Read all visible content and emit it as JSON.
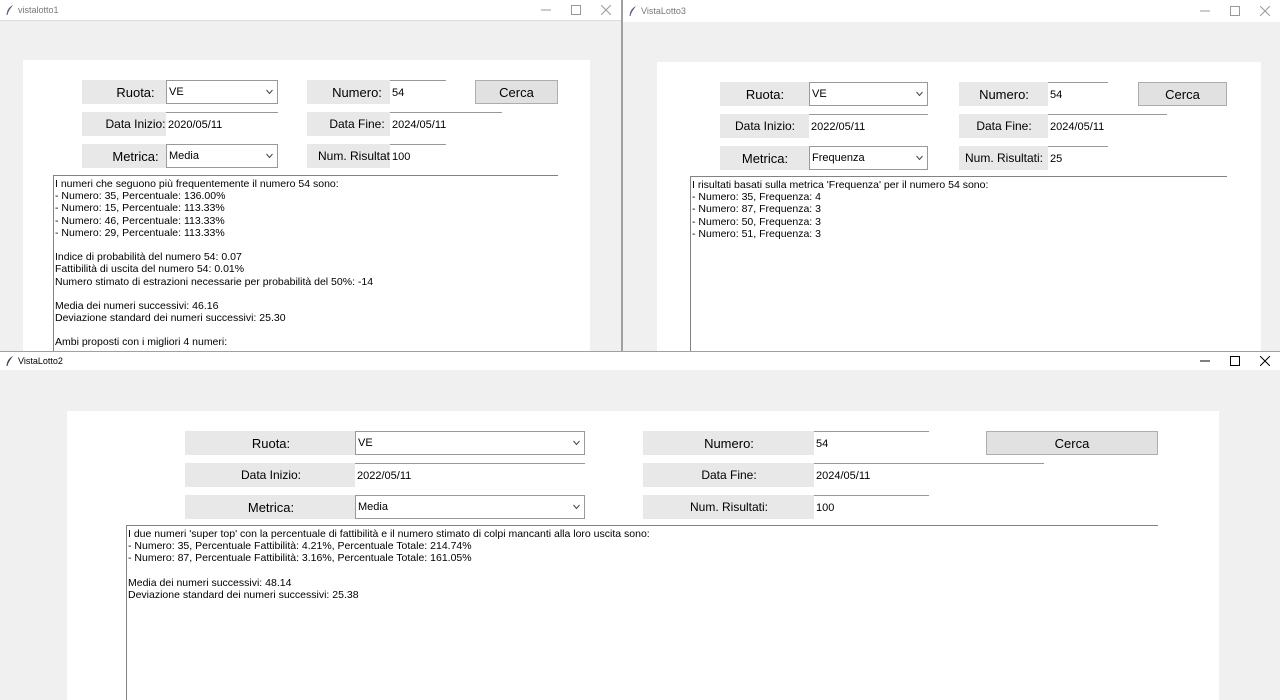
{
  "win1": {
    "title": "vistalotto1",
    "ruota_label": "Ruota:",
    "ruota_value": "VE",
    "numero_label": "Numero:",
    "numero_value": "54",
    "cerca_label": "Cerca",
    "data_inizio_label": "Data Inizio:",
    "data_inizio_value": "2020/05/11",
    "data_fine_label": "Data Fine:",
    "data_fine_value": "2024/05/11",
    "metrica_label": "Metrica:",
    "metrica_value": "Media",
    "num_risultati_label": "Num. Risultati:",
    "num_risultati_value": "100",
    "output_lines": [
      "I numeri che seguono più frequentemente il numero 54 sono:",
      "- Numero: 35, Percentuale: 136.00%",
      "- Numero: 15, Percentuale: 113.33%",
      "- Numero: 46, Percentuale: 113.33%",
      "- Numero: 29, Percentuale: 113.33%",
      "",
      "Indice di probabilità del numero 54: 0.07",
      "Fattibilità di uscita del numero 54: 0.01%",
      "Numero stimato di estrazioni necessarie per probabilità del 50%: -14",
      "",
      "Media dei numeri successivi: 46.16",
      "Deviazione standard dei numeri successivi: 25.30",
      "",
      "Ambi proposti con i migliori 4 numeri:"
    ]
  },
  "win3": {
    "title": "VistaLotto3",
    "ruota_label": "Ruota:",
    "ruota_value": "VE",
    "numero_label": "Numero:",
    "numero_value": "54",
    "cerca_label": "Cerca",
    "data_inizio_label": "Data Inizio:",
    "data_inizio_value": "2022/05/11",
    "data_fine_label": "Data Fine:",
    "data_fine_value": "2024/05/11",
    "metrica_label": "Metrica:",
    "metrica_value": "Frequenza",
    "num_risultati_label": "Num. Risultati:",
    "num_risultati_value": "25",
    "output_lines": [
      "I risultati basati sulla metrica 'Frequenza' per il numero 54 sono:",
      "- Numero: 35, Frequenza: 4",
      "- Numero: 87, Frequenza: 3",
      "- Numero: 50, Frequenza: 3",
      "- Numero: 51, Frequenza: 3"
    ]
  },
  "win2": {
    "title": "VistaLotto2",
    "ruota_label": "Ruota:",
    "ruota_value": "VE",
    "numero_label": "Numero:",
    "numero_value": "54",
    "cerca_label": "Cerca",
    "data_inizio_label": "Data Inizio:",
    "data_inizio_value": "2022/05/11",
    "data_fine_label": "Data Fine:",
    "data_fine_value": "2024/05/11",
    "metrica_label": "Metrica:",
    "metrica_value": "Media",
    "num_risultati_label": "Num. Risultati:",
    "num_risultati_value": "100",
    "output_lines": [
      "I due numeri 'super top' con la percentuale di fattibilità e il numero stimato di colpi mancanti alla loro uscita sono:",
      "- Numero: 35, Percentuale Fattibilità: 4.21%, Percentuale Totale: 214.74%",
      "- Numero: 87, Percentuale Fattibilità: 3.16%, Percentuale Totale: 161.05%",
      "",
      "Media dei numeri successivi: 48.14",
      "Deviazione standard dei numeri successivi: 25.38"
    ]
  },
  "icons": {
    "app_icon": "feather-icon",
    "minimize": "minimize-icon",
    "maximize": "maximize-icon",
    "close": "close-icon",
    "dropdown": "chevron-down-icon"
  },
  "colors": {
    "window_bg": "#f0f0f0",
    "canvas_bg": "#ffffff",
    "label_bg": "#e8e8e8",
    "button_bg": "#e1e1e1"
  }
}
